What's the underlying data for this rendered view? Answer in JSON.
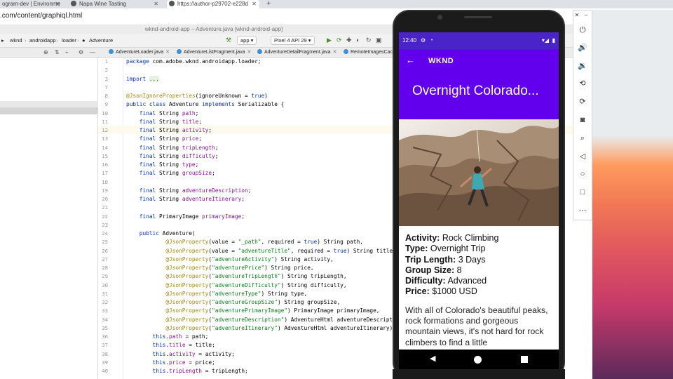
{
  "browser": {
    "tabs": [
      {
        "label": "ogram-dev | Environme"
      },
      {
        "label": "Napa Wine Tasting"
      },
      {
        "label": "https://author-p29702-e228d"
      }
    ],
    "url": ".com/content/graphiql.html"
  },
  "ide": {
    "window_title": "wknd-android-app – Adventure.java [wknd-android-app]",
    "breadcrumbs": [
      "wknd",
      "androidapp",
      "loader",
      "Adventure"
    ],
    "run_config": "app",
    "device": "Pixel 4 API 29",
    "editor_tabs": [
      "AdventureLoader.java",
      "AdventureListFragment.java",
      "AdventureDetailFragment.java",
      "RemoteImagesCach"
    ],
    "code_lines": [
      {
        "n": "1",
        "segs": [
          {
            "t": "package ",
            "c": "kw"
          },
          {
            "t": "com.adobe.wknd.androidapp.loader;",
            "c": ""
          }
        ]
      },
      {
        "n": "2",
        "segs": []
      },
      {
        "n": "3",
        "segs": [
          {
            "t": "import ",
            "c": "kw"
          },
          {
            "t": "...",
            "c": "fold"
          }
        ]
      },
      {
        "n": "7",
        "segs": []
      },
      {
        "n": "8",
        "segs": [
          {
            "t": "@JsonIgnoreProperties",
            "c": "an"
          },
          {
            "t": "(ignoreUnknown = ",
            "c": ""
          },
          {
            "t": "true",
            "c": "kw"
          },
          {
            "t": ")",
            "c": ""
          }
        ]
      },
      {
        "n": "9",
        "segs": [
          {
            "t": "public class ",
            "c": "kw"
          },
          {
            "t": "Adventure ",
            "c": ""
          },
          {
            "t": "implements ",
            "c": "kw"
          },
          {
            "t": "Serializable {",
            "c": ""
          }
        ]
      },
      {
        "n": "10",
        "segs": [
          {
            "t": "    final ",
            "c": "kw"
          },
          {
            "t": "String ",
            "c": ""
          },
          {
            "t": "path",
            "c": "fd"
          },
          {
            "t": ";",
            "c": ""
          }
        ]
      },
      {
        "n": "11",
        "segs": [
          {
            "t": "    final ",
            "c": "kw"
          },
          {
            "t": "String ",
            "c": ""
          },
          {
            "t": "title",
            "c": "fd"
          },
          {
            "t": ";",
            "c": ""
          }
        ]
      },
      {
        "n": "12",
        "segs": [
          {
            "t": "    final ",
            "c": "kw"
          },
          {
            "t": "String ",
            "c": ""
          },
          {
            "t": "activity",
            "c": "fd"
          },
          {
            "t": ";",
            "c": ""
          }
        ]
      },
      {
        "n": "13",
        "segs": [
          {
            "t": "    final ",
            "c": "kw"
          },
          {
            "t": "String ",
            "c": ""
          },
          {
            "t": "price",
            "c": "fd"
          },
          {
            "t": ";",
            "c": ""
          }
        ]
      },
      {
        "n": "14",
        "segs": [
          {
            "t": "    final ",
            "c": "kw"
          },
          {
            "t": "String ",
            "c": ""
          },
          {
            "t": "tripLength",
            "c": "fd"
          },
          {
            "t": ";",
            "c": ""
          }
        ]
      },
      {
        "n": "15",
        "segs": [
          {
            "t": "    final ",
            "c": "kw"
          },
          {
            "t": "String ",
            "c": ""
          },
          {
            "t": "difficulty",
            "c": "fd"
          },
          {
            "t": ";",
            "c": ""
          }
        ]
      },
      {
        "n": "16",
        "segs": [
          {
            "t": "    final ",
            "c": "kw"
          },
          {
            "t": "String ",
            "c": ""
          },
          {
            "t": "type",
            "c": "fd"
          },
          {
            "t": ";",
            "c": ""
          }
        ]
      },
      {
        "n": "17",
        "segs": [
          {
            "t": "    final ",
            "c": "kw"
          },
          {
            "t": "String ",
            "c": ""
          },
          {
            "t": "groupSize",
            "c": "fd"
          },
          {
            "t": ";",
            "c": ""
          }
        ]
      },
      {
        "n": "18",
        "segs": []
      },
      {
        "n": "19",
        "segs": [
          {
            "t": "    final ",
            "c": "kw"
          },
          {
            "t": "String ",
            "c": ""
          },
          {
            "t": "adventureDescription",
            "c": "fd"
          },
          {
            "t": ";",
            "c": ""
          }
        ]
      },
      {
        "n": "20",
        "segs": [
          {
            "t": "    final ",
            "c": "kw"
          },
          {
            "t": "String ",
            "c": ""
          },
          {
            "t": "adventureItinerary",
            "c": "fd"
          },
          {
            "t": ";",
            "c": ""
          }
        ]
      },
      {
        "n": "21",
        "segs": []
      },
      {
        "n": "22",
        "segs": [
          {
            "t": "    final ",
            "c": "kw"
          },
          {
            "t": "PrimaryImage ",
            "c": ""
          },
          {
            "t": "primaryImage",
            "c": "fd"
          },
          {
            "t": ";",
            "c": ""
          }
        ]
      },
      {
        "n": "23",
        "segs": []
      },
      {
        "n": "24",
        "segs": [
          {
            "t": "    public ",
            "c": "kw"
          },
          {
            "t": "Adventure(",
            "c": ""
          }
        ]
      },
      {
        "n": "25",
        "segs": [
          {
            "t": "            @JsonProperty",
            "c": "an"
          },
          {
            "t": "(value = ",
            "c": ""
          },
          {
            "t": "\"_path\"",
            "c": "st"
          },
          {
            "t": ", required = ",
            "c": ""
          },
          {
            "t": "true",
            "c": "kw"
          },
          {
            "t": ") String path,",
            "c": ""
          }
        ]
      },
      {
        "n": "26",
        "segs": [
          {
            "t": "            @JsonProperty",
            "c": "an"
          },
          {
            "t": "(value = ",
            "c": ""
          },
          {
            "t": "\"adventureTitle\"",
            "c": "st"
          },
          {
            "t": ", required = ",
            "c": ""
          },
          {
            "t": "true",
            "c": "kw"
          },
          {
            "t": ") String title",
            "c": ""
          }
        ]
      },
      {
        "n": "27",
        "segs": [
          {
            "t": "            @JsonProperty",
            "c": "an"
          },
          {
            "t": "(",
            "c": ""
          },
          {
            "t": "\"adventureActivity\"",
            "c": "st"
          },
          {
            "t": ") String activity,",
            "c": ""
          }
        ]
      },
      {
        "n": "28",
        "segs": [
          {
            "t": "            @JsonProperty",
            "c": "an"
          },
          {
            "t": "(",
            "c": ""
          },
          {
            "t": "\"adventurePrice\"",
            "c": "st"
          },
          {
            "t": ") String price,",
            "c": ""
          }
        ]
      },
      {
        "n": "29",
        "segs": [
          {
            "t": "            @JsonProperty",
            "c": "an"
          },
          {
            "t": "(",
            "c": ""
          },
          {
            "t": "\"adventureTripLength\"",
            "c": "st"
          },
          {
            "t": ") String tripLength,",
            "c": ""
          }
        ]
      },
      {
        "n": "30",
        "segs": [
          {
            "t": "            @JsonProperty",
            "c": "an"
          },
          {
            "t": "(",
            "c": ""
          },
          {
            "t": "\"adventureDifficulty\"",
            "c": "st"
          },
          {
            "t": ") String difficulty,",
            "c": ""
          }
        ]
      },
      {
        "n": "31",
        "segs": [
          {
            "t": "            @JsonProperty",
            "c": "an"
          },
          {
            "t": "(",
            "c": ""
          },
          {
            "t": "\"adventureType\"",
            "c": "st"
          },
          {
            "t": ") String type,",
            "c": ""
          }
        ]
      },
      {
        "n": "32",
        "segs": [
          {
            "t": "            @JsonProperty",
            "c": "an"
          },
          {
            "t": "(",
            "c": ""
          },
          {
            "t": "\"adventureGroupSize\"",
            "c": "st"
          },
          {
            "t": ") String groupSize,",
            "c": ""
          }
        ]
      },
      {
        "n": "33",
        "segs": [
          {
            "t": "            @JsonProperty",
            "c": "an"
          },
          {
            "t": "(",
            "c": ""
          },
          {
            "t": "\"adventurePrimaryImage\"",
            "c": "st"
          },
          {
            "t": ") PrimaryImage primaryImage,",
            "c": ""
          }
        ]
      },
      {
        "n": "34",
        "segs": [
          {
            "t": "            @JsonProperty",
            "c": "an"
          },
          {
            "t": "(",
            "c": ""
          },
          {
            "t": "\"adventureDescription\"",
            "c": "st"
          },
          {
            "t": ") AdventureHtml adventureDescript",
            "c": ""
          }
        ]
      },
      {
        "n": "35",
        "segs": [
          {
            "t": "            @JsonProperty",
            "c": "an"
          },
          {
            "t": "(",
            "c": ""
          },
          {
            "t": "\"adventureItinerary\"",
            "c": "st"
          },
          {
            "t": ") AdventureHtml adventureItinerary)",
            "c": ""
          }
        ]
      },
      {
        "n": "36",
        "segs": [
          {
            "t": "        this",
            "c": "kw"
          },
          {
            "t": ".",
            "c": ""
          },
          {
            "t": "path",
            "c": "fd"
          },
          {
            "t": " = path;",
            "c": ""
          }
        ]
      },
      {
        "n": "37",
        "segs": [
          {
            "t": "        this",
            "c": "kw"
          },
          {
            "t": ".",
            "c": ""
          },
          {
            "t": "title",
            "c": "fd"
          },
          {
            "t": " = title;",
            "c": ""
          }
        ]
      },
      {
        "n": "38",
        "segs": [
          {
            "t": "        this",
            "c": "kw"
          },
          {
            "t": ".",
            "c": ""
          },
          {
            "t": "activity",
            "c": "fd"
          },
          {
            "t": " = activity;",
            "c": ""
          }
        ]
      },
      {
        "n": "39",
        "segs": [
          {
            "t": "        this",
            "c": "kw"
          },
          {
            "t": ".",
            "c": ""
          },
          {
            "t": "price",
            "c": "fd"
          },
          {
            "t": " = price;",
            "c": ""
          }
        ]
      },
      {
        "n": "40",
        "segs": [
          {
            "t": "        this",
            "c": "kw"
          },
          {
            "t": ".",
            "c": ""
          },
          {
            "t": "tripLength",
            "c": "fd"
          },
          {
            "t": " = tripLength;",
            "c": ""
          }
        ]
      }
    ]
  },
  "phone": {
    "time": "12:40",
    "app_title": "WKND",
    "adventure_title": "Overnight Colorado...",
    "details": [
      {
        "label": "Activity:",
        "value": "Rock Climbing"
      },
      {
        "label": "Type:",
        "value": "Overnight Trip"
      },
      {
        "label": "Trip Length:",
        "value": "3 Days"
      },
      {
        "label": "Group Size:",
        "value": "8"
      },
      {
        "label": "Difficulty:",
        "value": "Advanced"
      },
      {
        "label": "Price:",
        "value": "$1000 USD"
      }
    ],
    "description": "With all of Colorado's beautiful peaks, rock formations and gorgeous mountain views, it's not hard for rock climbers to find a little",
    "accent_color": "#6200ee",
    "status_color": "#4a24c9"
  },
  "emulator_toolbar": {
    "icons": [
      "power-icon",
      "volume-up-icon",
      "volume-down-icon",
      "rotate-left-icon",
      "rotate-right-icon",
      "camera-icon",
      "zoom-icon",
      "back-icon",
      "home-icon",
      "overview-icon",
      "more-icon"
    ]
  }
}
